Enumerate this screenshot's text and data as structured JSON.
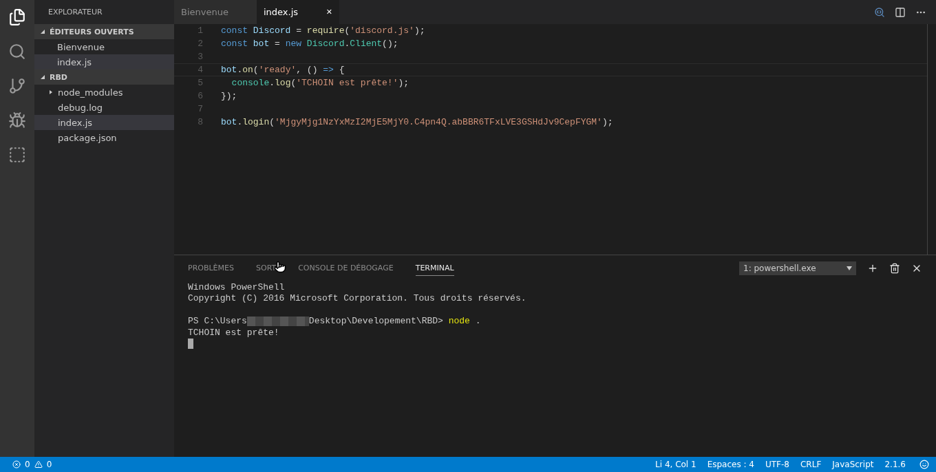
{
  "activity_bar": [
    {
      "kind": "files",
      "selected": true
    },
    {
      "kind": "search",
      "selected": false
    },
    {
      "kind": "git",
      "selected": false
    },
    {
      "kind": "debug",
      "selected": false
    },
    {
      "kind": "extensions",
      "selected": false
    }
  ],
  "sidebar": {
    "title": "EXPLORATEUR",
    "sections": [
      {
        "label": "ÉDITEURS OUVERTS",
        "expanded": true,
        "items": [
          {
            "label": "Bienvenue",
            "selected": false
          },
          {
            "label": "index.js",
            "selected": true
          }
        ]
      },
      {
        "label": "RBD",
        "expanded": true,
        "items": [
          {
            "label": "node_modules",
            "folder": true,
            "selected": false
          },
          {
            "label": "debug.log",
            "folder": false,
            "selected": false
          },
          {
            "label": "index.js",
            "folder": false,
            "selected": true
          },
          {
            "label": "package.json",
            "folder": false,
            "selected": false
          }
        ]
      }
    ]
  },
  "tabs": [
    {
      "label": "Bienvenue",
      "selected": false
    },
    {
      "label": "index.js",
      "selected": true,
      "close": "✕"
    }
  ],
  "editor": {
    "lines": [
      {
        "number": "1",
        "current": false,
        "tokens": [
          {
            "kind": "keyword",
            "text": "const"
          },
          {
            "kind": "variable",
            "text": " Discord"
          },
          {
            "kind": "plain",
            "text": " = "
          },
          {
            "kind": "function",
            "text": "require"
          },
          {
            "kind": "plain",
            "text": "("
          },
          {
            "kind": "string",
            "text": "'discord.js'"
          },
          {
            "kind": "plain",
            "text": ");"
          }
        ]
      },
      {
        "number": "2",
        "current": false,
        "tokens": [
          {
            "kind": "keyword",
            "text": "const"
          },
          {
            "kind": "variable",
            "text": " bot"
          },
          {
            "kind": "plain",
            "text": " = "
          },
          {
            "kind": "keyword",
            "text": "new"
          },
          {
            "kind": "class",
            "text": " Discord"
          },
          {
            "kind": "plain",
            "text": "."
          },
          {
            "kind": "class",
            "text": "Client"
          },
          {
            "kind": "plain",
            "text": "();"
          }
        ]
      },
      {
        "number": "3",
        "current": false
      },
      {
        "number": "4",
        "current": true,
        "tokens": [
          {
            "kind": "variable",
            "text": "bot"
          },
          {
            "kind": "plain",
            "text": "."
          },
          {
            "kind": "function",
            "text": "on"
          },
          {
            "kind": "plain",
            "text": "("
          },
          {
            "kind": "string",
            "text": "'ready'"
          },
          {
            "kind": "plain",
            "text": ", () "
          },
          {
            "kind": "keyword",
            "text": "=>"
          },
          {
            "kind": "plain",
            "text": " {"
          }
        ]
      },
      {
        "number": "5",
        "current": false,
        "tokens": [
          {
            "kind": "class",
            "text": "  console"
          },
          {
            "kind": "plain",
            "text": "."
          },
          {
            "kind": "function",
            "text": "log"
          },
          {
            "kind": "plain",
            "text": "("
          },
          {
            "kind": "string",
            "text": "'TCHOIN est prête!'"
          },
          {
            "kind": "plain",
            "text": ");"
          }
        ]
      },
      {
        "number": "6",
        "current": false,
        "tokens": [
          {
            "kind": "plain",
            "text": "});"
          }
        ]
      },
      {
        "number": "7",
        "current": false
      },
      {
        "number": "8",
        "current": false,
        "tokens": [
          {
            "kind": "variable",
            "text": "bot"
          },
          {
            "kind": "plain",
            "text": "."
          },
          {
            "kind": "function",
            "text": "login"
          },
          {
            "kind": "plain",
            "text": "("
          },
          {
            "kind": "string",
            "text": "'MjgyMjg1NzYxMzI2MjE5MjY0.C4pn4Q.abBBR6TFxLVE3GSHdJv9CepFYGM'"
          },
          {
            "kind": "plain",
            "text": ");"
          }
        ]
      }
    ]
  },
  "panel": {
    "tabs": [
      {
        "label": "PROBLÈMES",
        "selected": false,
        "hovered": false
      },
      {
        "label": "SORT",
        "selected": false,
        "hovered": true
      },
      {
        "label": "CONSOLE DE DÉBOGAGE",
        "selected": false,
        "hovered": false
      },
      {
        "label": "TERMINAL",
        "selected": true,
        "hovered": false
      }
    ],
    "terminal_select": "1: powershell.exe",
    "terminal": [
      {
        "segments": [
          {
            "kind": "plain",
            "text": "Windows PowerShell"
          }
        ]
      },
      {
        "segments": [
          {
            "kind": "plain",
            "text": "Copyright (C) 2016 Microsoft Corporation. Tous droits réservés."
          }
        ]
      },
      {
        "segments": [
          {
            "kind": "blank"
          }
        ]
      },
      {
        "segments": [
          {
            "kind": "plain",
            "text": "PS C:\\Users"
          },
          {
            "kind": "redacted"
          },
          {
            "kind": "plain",
            "text": "Desktop\\Developement\\RBD> "
          },
          {
            "kind": "command",
            "text": "node"
          },
          {
            "kind": "plain",
            "text": " ."
          }
        ]
      },
      {
        "segments": [
          {
            "kind": "plain",
            "text": "TCHOIN est prête!"
          }
        ]
      },
      {
        "segments": [
          {
            "kind": "cursor"
          }
        ]
      }
    ]
  },
  "status_bar": {
    "errors": "0",
    "warnings": "0",
    "items": [
      "Li 4, Col 1",
      "Espaces : 4",
      "UTF-8",
      "CRLF",
      "JavaScript",
      "2.1.6"
    ]
  }
}
